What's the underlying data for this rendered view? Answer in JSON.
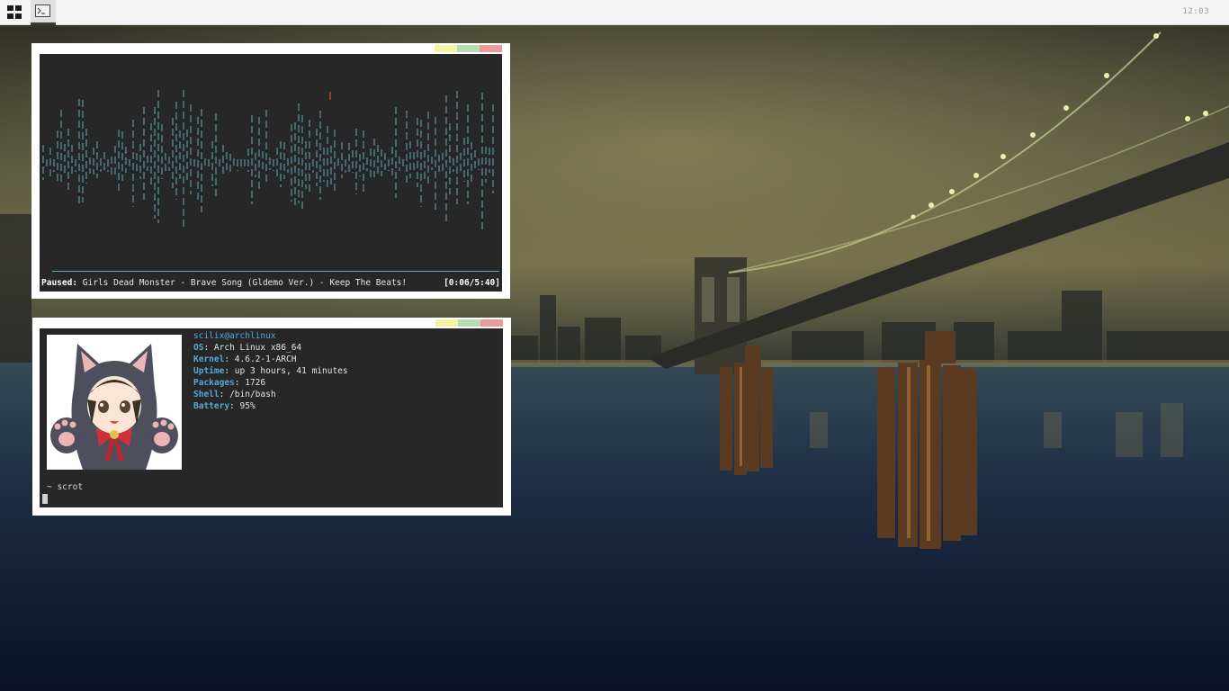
{
  "topbar": {
    "menu_icon": "grid-icon",
    "task_icon": "terminal-icon",
    "clock": "12:03"
  },
  "music": {
    "status_label": "Paused:",
    "track": "Girls Dead Monster - Brave Song (Gldemo Ver.) - Keep The Beats!",
    "time": "[0:06/5:40]",
    "progress": 0.018,
    "colors": {
      "bars": "#5fa8b8",
      "peak": "#e0603a",
      "background": "#272727"
    }
  },
  "terminal": {
    "user_host": "scilix@archlinux",
    "info": [
      {
        "key": "OS",
        "value": "Arch Linux x86_64"
      },
      {
        "key": "Kernel",
        "value": "4.6.2-1-ARCH"
      },
      {
        "key": "Uptime",
        "value": "up 3 hours, 41 minutes"
      },
      {
        "key": "Packages",
        "value": "1726"
      },
      {
        "key": "Shell",
        "value": "/bin/bash"
      },
      {
        "key": "Battery",
        "value": "95%"
      }
    ],
    "prompt": "~ scrot",
    "colors": {
      "accent": "#52a9d8",
      "background": "#272727"
    }
  },
  "window_buttons": {
    "minimize": "#f3f3a3",
    "maximize": "#b7ddb2",
    "close": "#ec9a9a"
  }
}
